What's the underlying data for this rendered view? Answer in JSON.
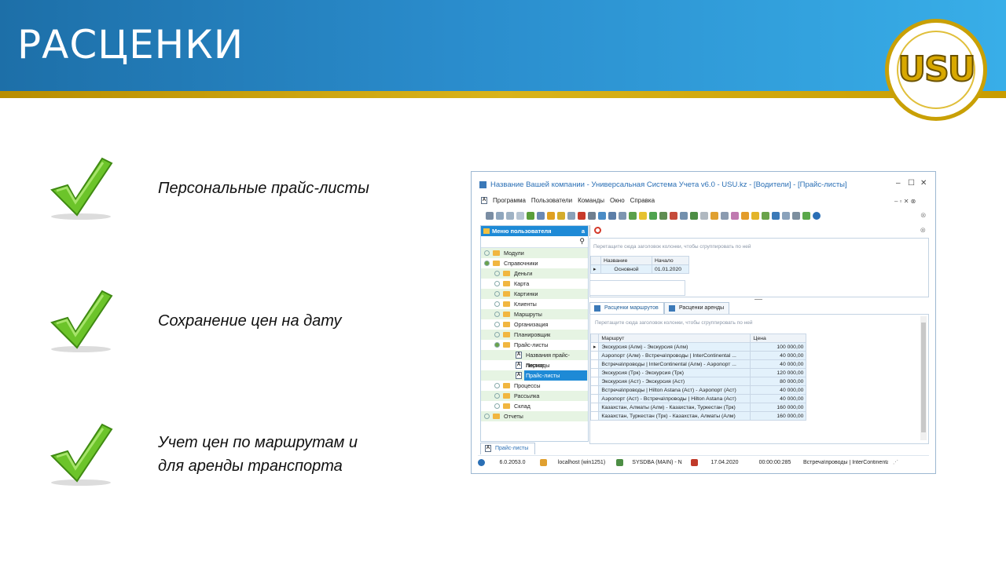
{
  "slide": {
    "title": "РАСЦЕНКИ",
    "logo_text": "USU",
    "bullets": [
      {
        "lines": [
          "Персональные прайс-листы"
        ]
      },
      {
        "lines": [
          "Сохранение цен на дату"
        ]
      },
      {
        "lines": [
          "Учет цен по маршрутам и",
          "для аренды транспорта"
        ]
      }
    ]
  },
  "window": {
    "title": "Название Вашей компании - Универсальная Система Учета v6.0 - USU.kz - [Водители] - [Прайс-листы]",
    "controls": [
      "–",
      "☐",
      "✕"
    ],
    "menu": [
      "Программа",
      "Пользователи",
      "Команды",
      "Окно",
      "Справка"
    ],
    "left_panel": {
      "header": "Меню пользователя",
      "pin": "a",
      "tree": [
        {
          "label": "Модули",
          "level": 0,
          "type": "plus"
        },
        {
          "label": "Справочники",
          "level": 0,
          "type": "open"
        },
        {
          "label": "Деньги",
          "level": 1,
          "type": "plus"
        },
        {
          "label": "Карта",
          "level": 1,
          "type": "plus"
        },
        {
          "label": "Картинки",
          "level": 1,
          "type": "plus"
        },
        {
          "label": "Клиенты",
          "level": 1,
          "type": "plus"
        },
        {
          "label": "Маршруты",
          "level": 1,
          "type": "plus"
        },
        {
          "label": "Организация",
          "level": 1,
          "type": "plus"
        },
        {
          "label": "Планировщик",
          "level": 1,
          "type": "plus"
        },
        {
          "label": "Прайс-листы",
          "level": 1,
          "type": "open"
        },
        {
          "label": "Названия прайс-листов",
          "level": 2,
          "type": "doc"
        },
        {
          "label": "Периоды",
          "level": 2,
          "type": "doc"
        },
        {
          "label": "Прайс-листы",
          "level": 2,
          "type": "doc",
          "selected": true
        },
        {
          "label": "Процессы",
          "level": 1,
          "type": "plus"
        },
        {
          "label": "Рассылка",
          "level": 1,
          "type": "plus"
        },
        {
          "label": "Склад",
          "level": 1,
          "type": "plus"
        },
        {
          "label": "Отчеты",
          "level": 0,
          "type": "plus"
        }
      ]
    },
    "group_hint": "Перетащите сюда заголовок колонки, чтобы сгруппировать по ней",
    "top_grid": {
      "headers": [
        "Название",
        "Начало"
      ],
      "rows": [
        [
          "Основной",
          "01.01.2020"
        ]
      ]
    },
    "tabs": [
      "Расценки маршрутов",
      "Расценки аренды"
    ],
    "bottom_grid": {
      "headers": [
        "Маршрут",
        "Цена"
      ],
      "rows": [
        [
          "Экскурсия (Алм) - Экскурсия (Алм)",
          "100 000,00"
        ],
        [
          "Аэропорт (Алм) - Встреча\\проводы | InterContinental ...",
          "40 000,00"
        ],
        [
          "Встреча\\проводы | InterContinental (Алм) - Аэропорт ...",
          "40 000,00"
        ],
        [
          "Экскурсия (Трк) - Экскурсия (Трк)",
          "120 000,00"
        ],
        [
          "Экскурсия (Аст) - Экскурсия (Аст)",
          "80 000,00"
        ],
        [
          "Встреча\\проводы | Hilton Astana (Аст) - Аэропорт (Аст)",
          "40 000,00"
        ],
        [
          "Аэропорт (Аст) - Встреча\\проводы | Hilton Astana (Аст)",
          "40 000,00"
        ],
        [
          "Казахстан, Алматы (Алм) - Казахстан, Туркестан (Трк)",
          "160 000,00"
        ],
        [
          "Казахстан, Туркестан (Трк) - Казахстан, Алматы (Алм)",
          "160 000,00"
        ]
      ]
    },
    "bottom_tab": "Прайс-листы",
    "status": {
      "version": "6.0.2053.0",
      "host": "localhost (win1251)",
      "user": "SYSDBA (MAIN) - N",
      "date": "17.04.2020",
      "timer": "00:00:00:285",
      "current": "Встреча\\проводы | InterContinental (Алм)"
    }
  }
}
